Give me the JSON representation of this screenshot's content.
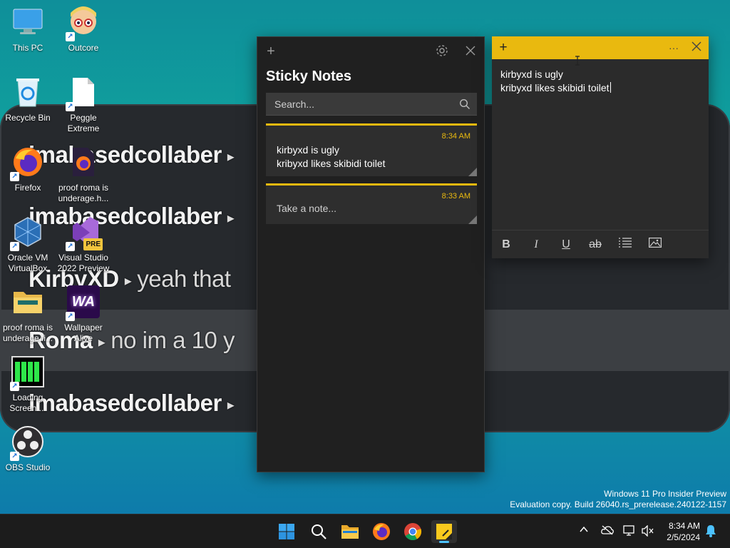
{
  "wallpaper": {
    "lines": [
      {
        "user": "imabasedcollaber",
        "msg": ""
      },
      {
        "user": "imabasedcollaber",
        "msg": ""
      },
      {
        "user": "KirbyXD",
        "msg": "yeah that"
      },
      {
        "user": "Roma",
        "msg": "no im a 10 y"
      },
      {
        "user": "imabasedcollaber",
        "msg": ""
      }
    ]
  },
  "desktop": {
    "icons": [
      {
        "label": "This PC",
        "icon": "monitor-icon"
      },
      {
        "label": "Outcore",
        "icon": "outcore-icon"
      },
      {
        "label": "Recycle Bin",
        "icon": "recycle-bin-icon"
      },
      {
        "label": "Peggle Extreme",
        "icon": "file-icon"
      },
      {
        "label": "Firefox",
        "icon": "firefox-icon"
      },
      {
        "label": "proof roma is underage.h...",
        "icon": "firefox-html-file-icon"
      },
      {
        "label": "Oracle VM VirtualBox",
        "icon": "virtualbox-icon"
      },
      {
        "label": "Visual Studio 2022 Preview",
        "icon": "visual-studio-icon"
      },
      {
        "label": "proof roma is underage.fi...",
        "icon": "folder-icon"
      },
      {
        "label": "Wallpaper Alive",
        "icon": "wallpaper-alive-icon"
      },
      {
        "label": "Loading Screen ...",
        "icon": "loading-screen-icon"
      },
      {
        "label": "OBS Studio",
        "icon": "obs-icon"
      }
    ],
    "vs_badge": "PRE",
    "wa_badge": "WA"
  },
  "sticky_list": {
    "title": "Sticky Notes",
    "search_placeholder": "Search...",
    "notes": [
      {
        "time": "8:34 AM",
        "line1": "kirbyxd is ugly",
        "line2": "kribyxd likes skibidi toilet"
      },
      {
        "time": "8:33 AM",
        "line1": "Take a note...",
        "line2": ""
      }
    ]
  },
  "sticky_note": {
    "line1": "kirbyxd is ugly",
    "line2": "kribyxd likes skibidi toilet",
    "menu_glyph": "···"
  },
  "watermark": {
    "line1": "Windows 11 Pro Insider Preview",
    "line2": "Evaluation copy. Build 26040.rs_prerelease.240122-1157"
  },
  "taskbar": {
    "time": "8:34 AM",
    "date": "2/5/2024"
  },
  "colors": {
    "accent_yellow": "#e9b90f",
    "taskbar_indicator": "#4cc2ff"
  }
}
